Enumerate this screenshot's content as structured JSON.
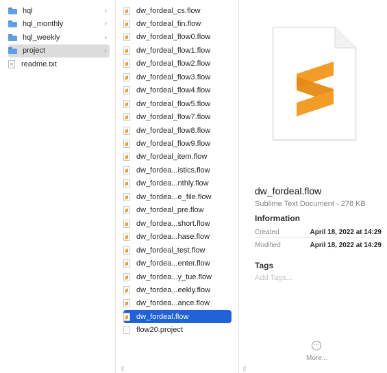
{
  "sidebar": {
    "items": [
      {
        "label": "hql",
        "icon": "folder-icon",
        "chevron": "›"
      },
      {
        "label": "hql_monthly",
        "icon": "folder-icon",
        "chevron": "›"
      },
      {
        "label": "hql_weekly",
        "icon": "folder-icon",
        "chevron": "›"
      },
      {
        "label": "project",
        "icon": "folder-icon",
        "chevron": "›"
      },
      {
        "label": "readme.txt",
        "icon": "text-file-icon"
      }
    ],
    "selected": "project"
  },
  "files": {
    "items": [
      "dw_fordeal_cs.flow",
      "dw_fordeal_fin.flow",
      "dw_fordeal_flow0.flow",
      "dw_fordeal_flow1.flow",
      "dw_fordeal_flow2.flow",
      "dw_fordeal_flow3.flow",
      "dw_fordeal_flow4.flow",
      "dw_fordeal_flow5.flow",
      "dw_fordeal_flow7.flow",
      "dw_fordeal_flow8.flow",
      "dw_fordeal_flow9.flow",
      "dw_fordeal_item.flow",
      "dw_fordea...istics.flow",
      "dw_fordea...nthly.flow",
      "dw_fordea...e_file.flow",
      "dw_fordeal_pre.flow",
      "dw_fordea...short.flow",
      "dw_fordea...hase.flow",
      "dw_fordeal_test.flow",
      "dw_fordea...enter.flow",
      "dw_fordea...y_tue.flow",
      "dw_fordea...eekly.flow",
      "dw_fordea...ance.flow",
      "dw_fordeal.flow",
      "flow20.project"
    ],
    "selected": "dw_fordeal.flow"
  },
  "preview": {
    "name": "dw_fordeal.flow",
    "kind": "Sublime Text Document - 278 KB",
    "information_title": "Information",
    "created_label": "Created",
    "created_value": "April 18, 2022 at 14:29",
    "modified_label": "Modified",
    "modified_value": "April 18, 2022 at 14:29",
    "tags_title": "Tags",
    "tags_placeholder": "Add Tags...",
    "more_label": "More...",
    "more_icon": "⋯"
  },
  "resize_handle_glyph": "||",
  "colors": {
    "selection_blue": "#1f63d6",
    "selection_gray": "#dcdcdc",
    "sublime_orange": "#f39c26",
    "folder_blue": "#5da0e6"
  }
}
